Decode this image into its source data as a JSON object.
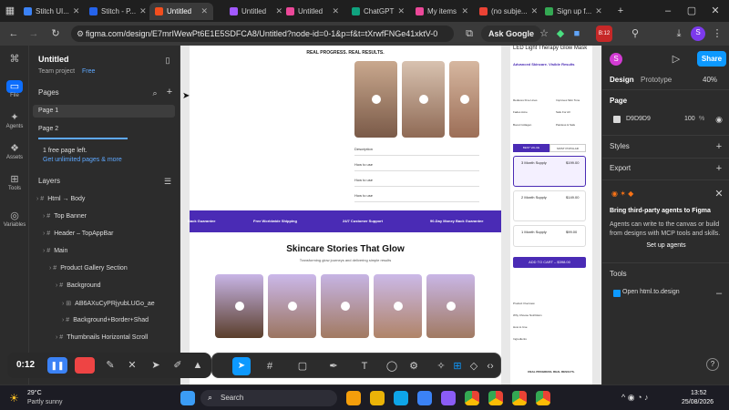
{
  "browser": {
    "tabs": [
      {
        "title": "Stitch UI...",
        "color": "#3b82f6",
        "active": false
      },
      {
        "title": "Stitch - P...",
        "color": "#2563eb",
        "active": false
      },
      {
        "title": "Untitled",
        "color": "#f24e1e",
        "active": true
      },
      {
        "title": "Untitled",
        "color": "#a259ff",
        "active": false
      },
      {
        "title": "Untitled",
        "color": "#ec4899",
        "active": false
      },
      {
        "title": "ChatGPT",
        "color": "#10a37f",
        "active": false
      },
      {
        "title": "My items",
        "color": "#ec4899",
        "active": false
      },
      {
        "title": "(no subje...",
        "color": "#ea4335",
        "active": false
      },
      {
        "title": "Sign up f...",
        "color": "#34a853",
        "active": false
      }
    ],
    "url": "figma.com/design/E7mrIWewPt6E1E5SDFCA8/Untitled?node-id=0-1&p=f&t=tXrwfFNGe41xktV-0",
    "ask_google": "Ask Google",
    "badge": "B:12"
  },
  "left": {
    "rail": [
      "File",
      "Agents",
      "Assets",
      "Tools",
      "Variables"
    ],
    "file_title": "Untitled",
    "team": "Team project",
    "plan": "Free",
    "pages_label": "Pages",
    "pages": [
      "Page 1",
      "Page 2"
    ],
    "page_left": "1 free page left.",
    "upgrade": "Get unlimited pages & more",
    "layers_label": "Layers",
    "layers": [
      {
        "name": "Html → Body",
        "indent": 0,
        "icon": "#"
      },
      {
        "name": "Top Banner",
        "indent": 1,
        "icon": "#"
      },
      {
        "name": "Header – TopAppBar",
        "indent": 1,
        "icon": "#"
      },
      {
        "name": "Main",
        "indent": 1,
        "icon": "#"
      },
      {
        "name": "Product Gallery Section",
        "indent": 2,
        "icon": "#"
      },
      {
        "name": "Background",
        "indent": 3,
        "icon": "#"
      },
      {
        "name": "AB6AXuCyPRjyubLUGo_ae",
        "indent": 4,
        "icon": "⊞"
      },
      {
        "name": "Background+Border+Shad",
        "indent": 4,
        "icon": "#"
      },
      {
        "name": "Thumbnails Horizontal Scroll",
        "indent": 3,
        "icon": "#"
      }
    ]
  },
  "canvas": {
    "results_title": "REAL PROGRESS. REAL RESULTS.",
    "accordion": [
      "Description",
      "How to use",
      "How to use",
      "How to use"
    ],
    "banner": [
      "Back Guarantee",
      "Free Worldwide Shipping",
      "24/7 Customer Support",
      "90-Day Money Back Guarantee"
    ],
    "stories_title": "Skincare Stories That Glow",
    "stories_sub": "Transforming glow journeys and delivering simple results",
    "product": {
      "title": "LED Light Therapy Glow Mask",
      "subtitle": "Advanced Skincare. Visible Results",
      "features": [
        "Reduces Fine Lines",
        "Improves Skin Tone",
        "Fades Acne",
        "Safe For All",
        "Boost Collagen",
        "Painless & Safe"
      ],
      "tabs": [
        "BEST VALUE",
        "MOST POPULAR"
      ],
      "options": [
        {
          "name": "3 Month Supply",
          "price": "$199.00"
        },
        {
          "name": "2 Month Supply",
          "price": "$149.00"
        },
        {
          "name": "1 Month Supply",
          "price": "$99.00"
        }
      ],
      "cta": "ADD TO CART – $398.00",
      "accordion": [
        "Product Overview",
        "Why Choose NutriGlam",
        "How to Use",
        "Ingredients"
      ],
      "results": "REAL PROGRESS. REAL RESULTS."
    }
  },
  "right": {
    "avatar": "S",
    "share": "Share",
    "zoom": "40%",
    "tabs": [
      "Design",
      "Prototype"
    ],
    "page_label": "Page",
    "page_color": "D9D9D9",
    "page_opacity": "100",
    "pct": "%",
    "styles": "Styles",
    "export": "Export",
    "agents_title": "Bring third-party agents to Figma",
    "agents_text": "Agents can write to the canvas or build from designs with MCP tools and skills.",
    "setup": "Set up agents",
    "tools": "Tools",
    "open_html": "Open html.to.design"
  },
  "toolbar": {
    "timer": "0:12"
  },
  "taskbar": {
    "weather_temp": "29°C",
    "weather_desc": "Partly sunny",
    "search": "Search",
    "time": "13:52",
    "date": "25/08/2026"
  },
  "colors": {
    "accent": "#0d99ff",
    "purple": "#4a2bb5",
    "rec": "#e44"
  }
}
